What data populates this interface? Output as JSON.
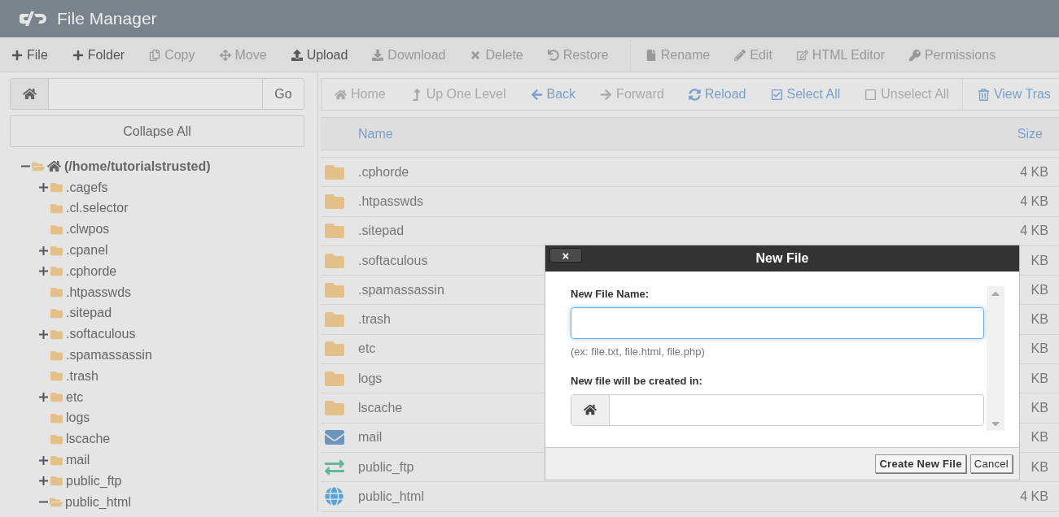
{
  "header": {
    "title": "File Manager"
  },
  "toolbar": [
    {
      "label": "File",
      "disabled": false
    },
    {
      "label": "Folder",
      "disabled": false
    },
    {
      "label": "Copy",
      "disabled": true
    },
    {
      "label": "Move",
      "disabled": true
    },
    {
      "label": "Upload",
      "disabled": false
    },
    {
      "label": "Download",
      "disabled": true
    },
    {
      "label": "Delete",
      "disabled": true
    },
    {
      "label": "Restore",
      "disabled": true
    },
    {
      "label": "Rename",
      "disabled": true
    },
    {
      "label": "Edit",
      "disabled": true
    },
    {
      "label": "HTML Editor",
      "disabled": true
    },
    {
      "label": "Permissions",
      "disabled": true
    }
  ],
  "path_bar": {
    "go": "Go"
  },
  "collapse_all": "Collapse All",
  "tree": {
    "label": "(/home/tutorialstrusted)",
    "expanded": true,
    "children": [
      {
        "label": ".cagefs",
        "expanded": false
      },
      {
        "label": ".cl.selector"
      },
      {
        "label": ".clwpos"
      },
      {
        "label": ".cpanel",
        "expanded": false
      },
      {
        "label": ".cphorde",
        "expanded": false
      },
      {
        "label": ".htpasswds"
      },
      {
        "label": ".sitepad"
      },
      {
        "label": ".softaculous",
        "expanded": false
      },
      {
        "label": ".spamassassin"
      },
      {
        "label": ".trash"
      },
      {
        "label": "etc",
        "expanded": false
      },
      {
        "label": "logs"
      },
      {
        "label": "lscache"
      },
      {
        "label": "mail",
        "expanded": false
      },
      {
        "label": "public_ftp",
        "expanded": false
      },
      {
        "label": "public_html",
        "expanded": true
      }
    ]
  },
  "nav": [
    {
      "label": "Home",
      "disabled": true
    },
    {
      "label": "Up One Level",
      "disabled": true
    },
    {
      "label": "Back",
      "disabled": false
    },
    {
      "label": "Forward",
      "disabled": true
    },
    {
      "label": "Reload",
      "disabled": false
    },
    {
      "label": "Select All",
      "disabled": false
    },
    {
      "label": "Unselect All",
      "disabled": true
    },
    {
      "label": "View Tras",
      "disabled": false
    }
  ],
  "table": {
    "columns": [
      "Name",
      "Size"
    ],
    "rows": [
      {
        "kind": "folder",
        "name": ".cphorde",
        "size": "4 KB"
      },
      {
        "kind": "folder",
        "name": ".htpasswds",
        "size": "4 KB"
      },
      {
        "kind": "folder",
        "name": ".sitepad",
        "size": "4 KB"
      },
      {
        "kind": "folder",
        "name": ".softaculous",
        "size": "KB"
      },
      {
        "kind": "folder",
        "name": ".spamassassin",
        "size": "KB"
      },
      {
        "kind": "folder",
        "name": ".trash",
        "size": "KB"
      },
      {
        "kind": "folder",
        "name": "etc",
        "size": "KB"
      },
      {
        "kind": "folder",
        "name": "logs",
        "size": "KB"
      },
      {
        "kind": "folder",
        "name": "lscache",
        "size": "KB"
      },
      {
        "kind": "mail",
        "name": "mail",
        "size": "KB"
      },
      {
        "kind": "transfer",
        "name": "public_ftp",
        "size": "KB"
      },
      {
        "kind": "web",
        "name": "public_html",
        "size": "4 KB"
      }
    ]
  },
  "dialog": {
    "title": "New File",
    "close": "×",
    "name_label": "New File Name:",
    "name_hint": "(ex: file.txt, file.html, file.php)",
    "location_label": "New file will be created in:",
    "buttons": [
      "Create New File",
      "Cancel"
    ]
  }
}
